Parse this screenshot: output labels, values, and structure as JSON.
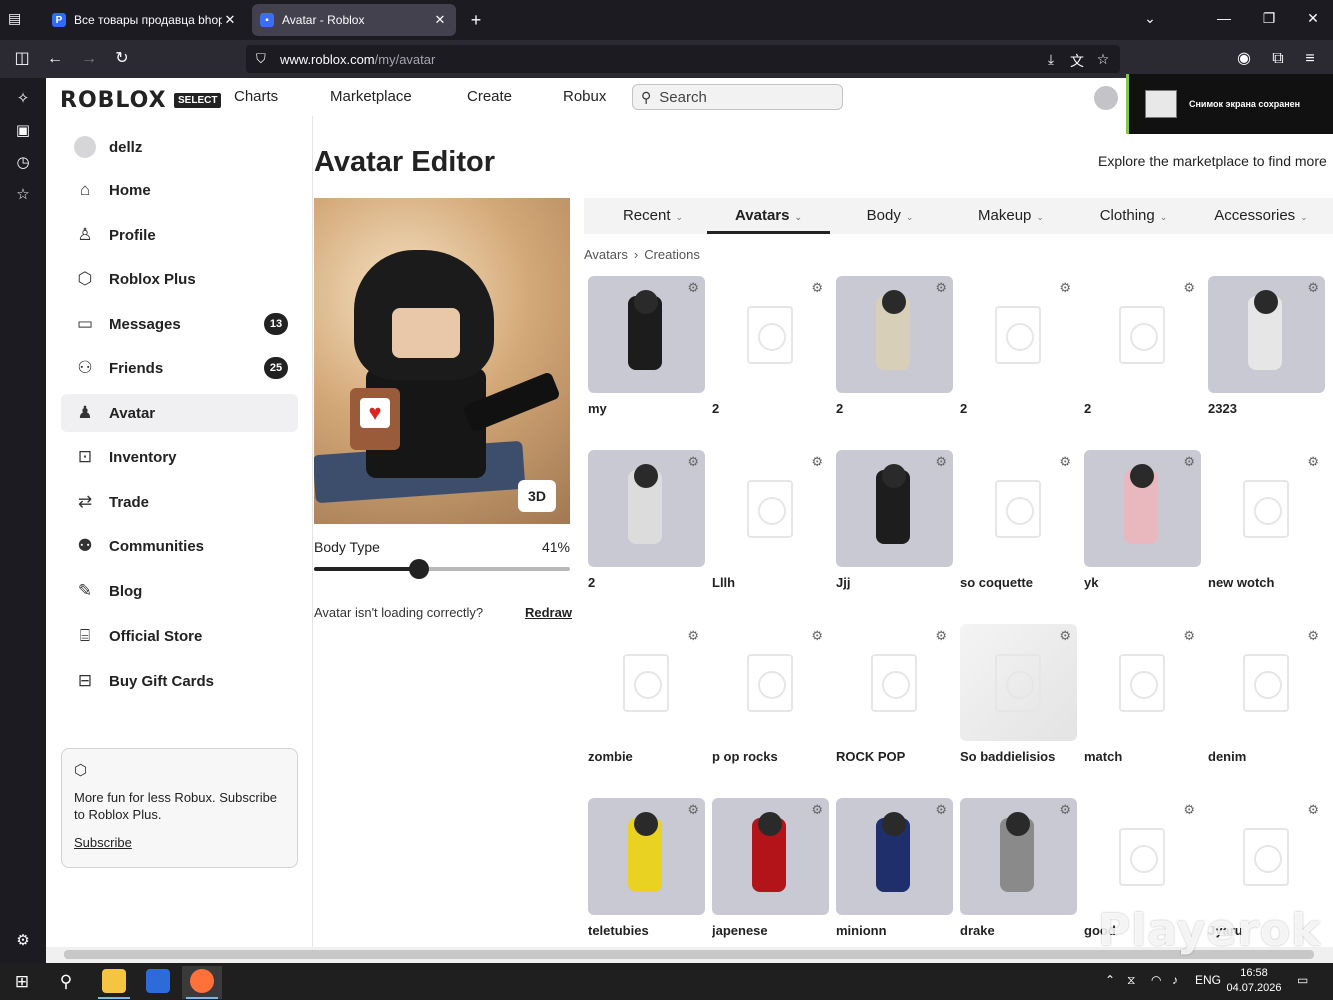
{
  "browser": {
    "tabs": [
      {
        "title": "Все товары продавца bhoppe",
        "favicon": "P",
        "active": false
      },
      {
        "title": "Avatar - Roblox",
        "favicon": "■",
        "active": true
      }
    ],
    "url_host": "www.roblox.com",
    "url_path": "/my/avatar"
  },
  "header": {
    "logo": "ROBLOX",
    "select_badge": "SELECT",
    "nav": [
      "Charts",
      "Marketplace",
      "Create",
      "Robux"
    ],
    "search_placeholder": "Search"
  },
  "notification_toast": {
    "text": "Снимок экрана сохранен"
  },
  "sidebar": {
    "username": "dellz",
    "items": [
      {
        "label": "Home",
        "icon": "home-icon"
      },
      {
        "label": "Profile",
        "icon": "profile-icon"
      },
      {
        "label": "Roblox Plus",
        "icon": "roblox-plus-icon"
      },
      {
        "label": "Messages",
        "icon": "messages-icon",
        "badge": "13"
      },
      {
        "label": "Friends",
        "icon": "friends-icon",
        "badge": "25"
      },
      {
        "label": "Avatar",
        "icon": "avatar-icon",
        "active": true
      },
      {
        "label": "Inventory",
        "icon": "inventory-icon"
      },
      {
        "label": "Trade",
        "icon": "trade-icon"
      },
      {
        "label": "Communities",
        "icon": "communities-icon"
      },
      {
        "label": "Blog",
        "icon": "blog-icon"
      },
      {
        "label": "Official Store",
        "icon": "store-icon"
      },
      {
        "label": "Buy Gift Cards",
        "icon": "gift-card-icon"
      }
    ],
    "promo": {
      "text": "More fun for less Robux. Subscribe to Roblox Plus.",
      "link": "Subscribe"
    }
  },
  "editor": {
    "title": "Avatar Editor",
    "explore_text": "Explore the marketplace to find more",
    "btn_3d": "3D",
    "body_type_label": "Body Type",
    "body_type_value": "41%",
    "body_type_fraction": 0.41,
    "loading_msg": "Avatar isn't loading correctly?",
    "redraw": "Redraw",
    "tabs": [
      "Recent",
      "Avatars",
      "Body",
      "Makeup",
      "Clothing",
      "Accessories"
    ],
    "active_tab": "Avatars",
    "breadcrumb": [
      "Avatars",
      "Creations"
    ],
    "outfits": [
      {
        "name": "my",
        "thumb": "filled",
        "color": "#1c1c1c"
      },
      {
        "name": "2",
        "thumb": "blank"
      },
      {
        "name": "2",
        "thumb": "filled",
        "color": "#d8cfb8"
      },
      {
        "name": "2",
        "thumb": "blank"
      },
      {
        "name": "2",
        "thumb": "blank"
      },
      {
        "name": "2323",
        "thumb": "filled",
        "color": "#e6e6e6"
      },
      {
        "name": "2",
        "thumb": "filled",
        "color": "#dcdcdc"
      },
      {
        "name": "Lllh",
        "thumb": "blank"
      },
      {
        "name": "Jjj",
        "thumb": "filled",
        "color": "#1d1d1d"
      },
      {
        "name": "so coquette",
        "thumb": "blank"
      },
      {
        "name": "yk",
        "thumb": "filled",
        "color": "#e8b8be"
      },
      {
        "name": "new wotch",
        "thumb": "blank"
      },
      {
        "name": "zombie",
        "thumb": "blank"
      },
      {
        "name": "p op rocks",
        "thumb": "blank"
      },
      {
        "name": "ROCK POP",
        "thumb": "blank"
      },
      {
        "name": "So baddielisios",
        "thumb": "grey"
      },
      {
        "name": "match",
        "thumb": "blank"
      },
      {
        "name": "denim",
        "thumb": "blank"
      },
      {
        "name": "teletubies",
        "thumb": "filled",
        "color": "#e9d221"
      },
      {
        "name": "japenese",
        "thumb": "filled",
        "color": "#b3141a"
      },
      {
        "name": "minionn",
        "thumb": "filled",
        "color": "#1f2f6b"
      },
      {
        "name": "drake",
        "thumb": "filled",
        "color": "#8a8a8a"
      },
      {
        "name": "good",
        "thumb": "blank"
      },
      {
        "name": "Jyaru",
        "thumb": "blank"
      }
    ]
  },
  "watermark": "Playerok",
  "taskbar": {
    "lang": "ENG",
    "time": "16:58",
    "date": "04.07.2026"
  }
}
